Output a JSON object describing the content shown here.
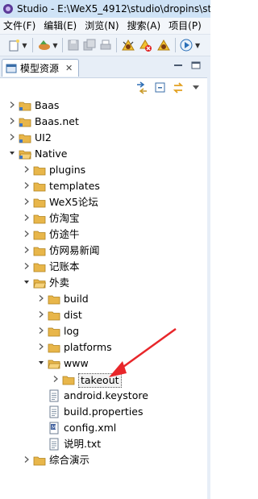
{
  "window": {
    "title": "Studio - E:\\WeX5_4912\\studio\\dropins\\stu"
  },
  "menu": [
    {
      "label": "文件(F)"
    },
    {
      "label": "编辑(E)"
    },
    {
      "label": "浏览(N)"
    },
    {
      "label": "搜索(A)"
    },
    {
      "label": "项目(P)"
    }
  ],
  "view": {
    "tab_label": "模型资源",
    "close_glyph": "✕"
  },
  "tree": [
    {
      "label": "Baas",
      "level": 0,
      "expanded": false,
      "type": "project"
    },
    {
      "label": "Baas.net",
      "level": 0,
      "expanded": false,
      "type": "project"
    },
    {
      "label": "UI2",
      "level": 0,
      "expanded": false,
      "type": "project"
    },
    {
      "label": "Native",
      "level": 0,
      "expanded": true,
      "type": "project"
    },
    {
      "label": "plugins",
      "level": 1,
      "expanded": false,
      "type": "folder"
    },
    {
      "label": "templates",
      "level": 1,
      "expanded": false,
      "type": "folder"
    },
    {
      "label": "WeX5论坛",
      "level": 1,
      "expanded": false,
      "type": "folder"
    },
    {
      "label": "仿淘宝",
      "level": 1,
      "expanded": false,
      "type": "folder"
    },
    {
      "label": "仿途牛",
      "level": 1,
      "expanded": false,
      "type": "folder"
    },
    {
      "label": "仿网易新闻",
      "level": 1,
      "expanded": false,
      "type": "folder"
    },
    {
      "label": "记账本",
      "level": 1,
      "expanded": false,
      "type": "folder"
    },
    {
      "label": "外卖",
      "level": 1,
      "expanded": true,
      "type": "folder"
    },
    {
      "label": "build",
      "level": 2,
      "expanded": false,
      "type": "folder"
    },
    {
      "label": "dist",
      "level": 2,
      "expanded": false,
      "type": "folder"
    },
    {
      "label": "log",
      "level": 2,
      "expanded": false,
      "type": "folder"
    },
    {
      "label": "platforms",
      "level": 2,
      "expanded": false,
      "type": "folder"
    },
    {
      "label": "www",
      "level": 2,
      "expanded": true,
      "type": "folder"
    },
    {
      "label": "takeout",
      "level": 3,
      "expanded": false,
      "type": "folder",
      "selected": true
    },
    {
      "label": "android.keystore",
      "level": 2,
      "type": "file"
    },
    {
      "label": "build.properties",
      "level": 2,
      "type": "file"
    },
    {
      "label": "config.xml",
      "level": 2,
      "type": "xml"
    },
    {
      "label": "说明.txt",
      "level": 2,
      "type": "file"
    },
    {
      "label": "综合演示",
      "level": 1,
      "expanded": false,
      "type": "folder"
    }
  ],
  "colors": {
    "annotation_arrow": "#e8262a",
    "folder": "#e8b64a",
    "titlebar": "#cfe3f6"
  }
}
